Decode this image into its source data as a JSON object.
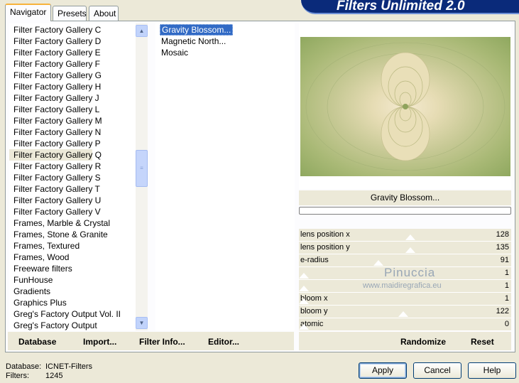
{
  "title": "Filters Unlimited 2.0",
  "tabs": [
    "Navigator",
    "Presets",
    "About"
  ],
  "categories": [
    "Filter Factory Gallery C",
    "Filter Factory Gallery D",
    "Filter Factory Gallery E",
    "Filter Factory Gallery F",
    "Filter Factory Gallery G",
    "Filter Factory Gallery H",
    "Filter Factory Gallery J",
    "Filter Factory Gallery L",
    "Filter Factory Gallery M",
    "Filter Factory Gallery N",
    "Filter Factory Gallery P",
    "Filter Factory Gallery Q",
    "Filter Factory Gallery R",
    "Filter Factory Gallery S",
    "Filter Factory Gallery T",
    "Filter Factory Gallery U",
    "Filter Factory Gallery V",
    "Frames, Marble & Crystal",
    "Frames, Stone & Granite",
    "Frames, Textured",
    "Frames, Wood",
    "Freeware filters",
    "FunHouse",
    "Gradients",
    "Graphics Plus",
    "Greg's Factory Output Vol. II",
    "Greg's Factory Output"
  ],
  "selected_category": "Filter Factory Gallery Q",
  "filters": [
    "Gravity Blossom...",
    "Magnetic North...",
    "Mosaic"
  ],
  "selected_filter": "Gravity Blossom...",
  "preview_title": "Gravity Blossom...",
  "params": [
    {
      "name": "lens position x",
      "value": "128"
    },
    {
      "name": "lens position y",
      "value": "135"
    },
    {
      "name": "e-radius",
      "value": "91"
    },
    {
      "name": "",
      "value": "1"
    },
    {
      "name": "",
      "value": "1"
    },
    {
      "name": "bloom x",
      "value": "1"
    },
    {
      "name": "bloom y",
      "value": "122"
    },
    {
      "name": "atomic",
      "value": "0"
    }
  ],
  "left_buttons": {
    "database": "Database",
    "import": "Import...",
    "filter_info": "Filter Info...",
    "editor": "Editor..."
  },
  "right_buttons": {
    "randomize": "Randomize",
    "reset": "Reset"
  },
  "footer": {
    "database_label": "Database:",
    "database_value": "ICNET-Filters",
    "filters_label": "Filters:",
    "filters_value": "1245"
  },
  "dialog_buttons": {
    "apply": "Apply",
    "cancel": "Cancel",
    "help": "Help"
  },
  "watermark": {
    "name": "Pinuccia",
    "url": "www.maidiregrafica.eu"
  }
}
